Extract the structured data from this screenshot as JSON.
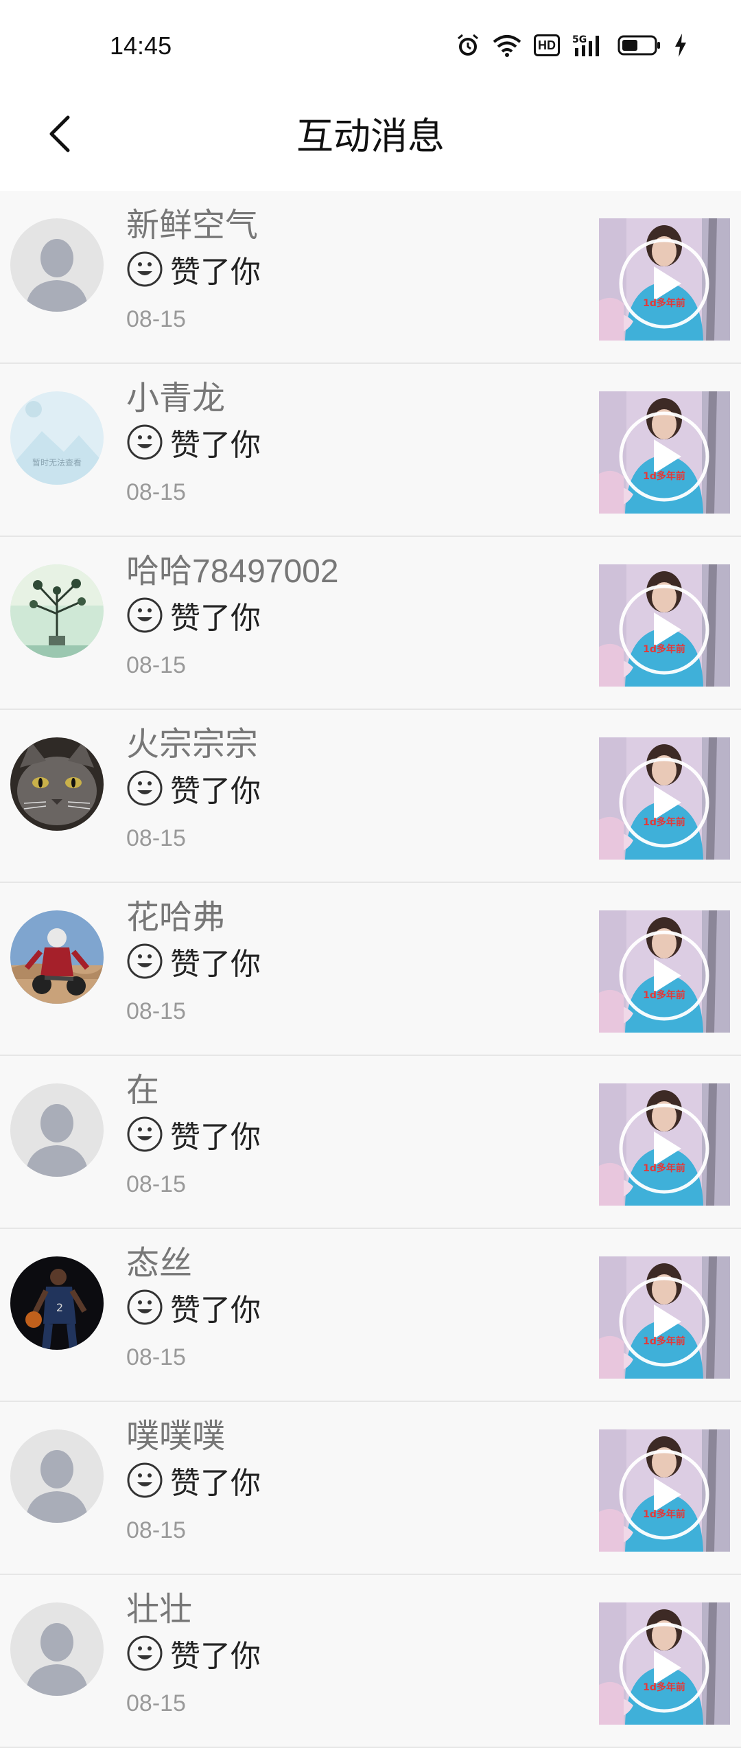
{
  "status_bar": {
    "time": "14:45",
    "icons": [
      "alarm-icon",
      "wifi-icon",
      "hd-badge",
      "5g-signal-icon",
      "battery-icon",
      "charging-icon"
    ],
    "hd_label": "HD"
  },
  "header": {
    "title": "互动消息",
    "back_icon": "back-arrow-icon"
  },
  "colors": {
    "background": "#f7f7f7",
    "header_bg": "#ffffff",
    "username": "#777777",
    "date": "#999999",
    "divider": "#e6e6e6"
  },
  "items": [
    {
      "name": "新鲜空气",
      "action": "赞了你",
      "date": "08-15",
      "avatar": "default-avatar-icon"
    },
    {
      "name": "小青龙",
      "action": "赞了你",
      "date": "08-15",
      "avatar": "unavailable-image-avatar",
      "avatar_text": "暂时无法查看"
    },
    {
      "name": "哈哈78497002",
      "action": "赞了你",
      "date": "08-15",
      "avatar": "plant-photo-avatar"
    },
    {
      "name": "火宗宗宗",
      "action": "赞了你",
      "date": "08-15",
      "avatar": "cat-photo-avatar"
    },
    {
      "name": "花哈弗",
      "action": "赞了你",
      "date": "08-15",
      "avatar": "motocross-photo-avatar"
    },
    {
      "name": "在",
      "action": "赞了你",
      "date": "08-15",
      "avatar": "default-avatar-icon"
    },
    {
      "name": "态丝",
      "action": "赞了你",
      "date": "08-15",
      "avatar": "basketball-player-avatar"
    },
    {
      "name": "噗噗噗",
      "action": "赞了你",
      "date": "08-15",
      "avatar": "default-avatar-icon"
    },
    {
      "name": "壮壮",
      "action": "赞了你",
      "date": "08-15",
      "avatar": "default-avatar-icon"
    }
  ],
  "video_thumbnail": {
    "icon": "play-button-icon",
    "caption_text": "1d多年前"
  }
}
